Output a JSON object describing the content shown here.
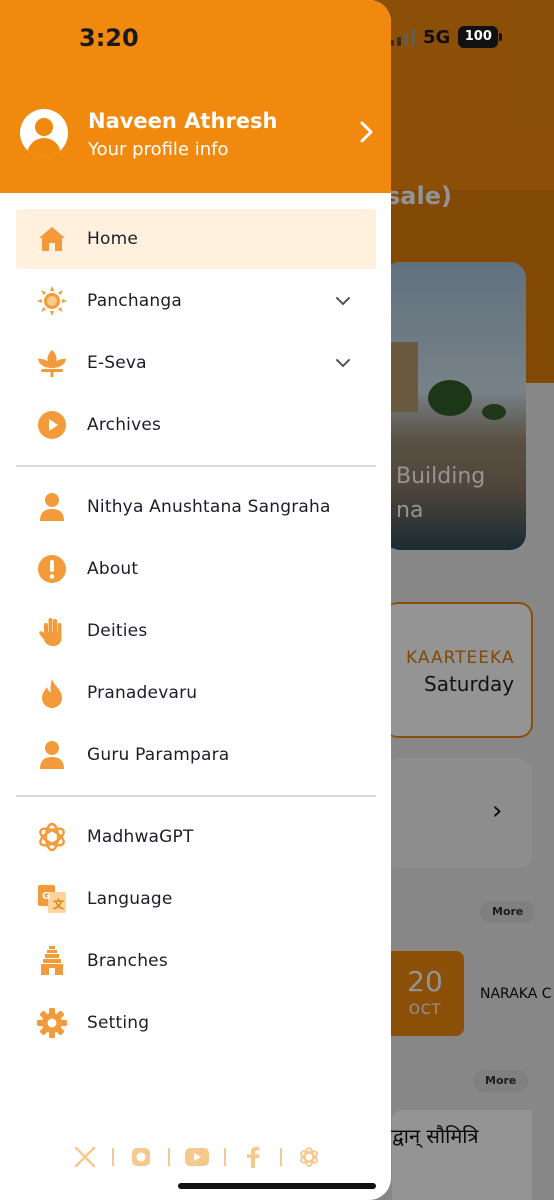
{
  "status_bar": {
    "time": "3:20",
    "network": "5G",
    "battery": "100"
  },
  "profile": {
    "name": "Naveen Athresh",
    "subtitle": "Your profile info"
  },
  "menu": {
    "primary": [
      {
        "label": "Home",
        "icon": "home-icon",
        "active": true
      },
      {
        "label": "Panchanga",
        "icon": "sun-icon",
        "expandable": true
      },
      {
        "label": "E-Seva",
        "icon": "lotus-icon",
        "expandable": true
      },
      {
        "label": "Archives",
        "icon": "play-circle-icon"
      }
    ],
    "secondary": [
      {
        "label": "Nithya Anushtana Sangraha",
        "icon": "person-icon"
      },
      {
        "label": "About",
        "icon": "info-icon"
      },
      {
        "label": "Deities",
        "icon": "hand-icon"
      },
      {
        "label": "Pranadevaru",
        "icon": "flame-icon"
      },
      {
        "label": "Guru Parampara",
        "icon": "person-icon"
      }
    ],
    "tertiary": [
      {
        "label": "MadhwaGPT",
        "icon": "openai-icon"
      },
      {
        "label": "Language",
        "icon": "translate-icon"
      },
      {
        "label": "Branches",
        "icon": "temple-icon"
      },
      {
        "label": "Setting",
        "icon": "gear-icon"
      }
    ]
  },
  "social": [
    "x-icon",
    "instagram-icon",
    "youtube-icon",
    "facebook-icon",
    "openai-icon"
  ],
  "background": {
    "title_fragment": "sale)",
    "photo_caption_1": "Building",
    "photo_caption_2": "na",
    "month": "KAARTEEKA",
    "weekday": "Saturday",
    "more_1": "More",
    "more_2": "More",
    "date_day": "20",
    "date_month": "OCT",
    "event": "NARAKA C",
    "hindi_text": "विद्वान् सौमित्रि"
  },
  "colors": {
    "accent": "#f0890e",
    "active_bg": "#fff1de",
    "text": "#1d1d2a"
  }
}
